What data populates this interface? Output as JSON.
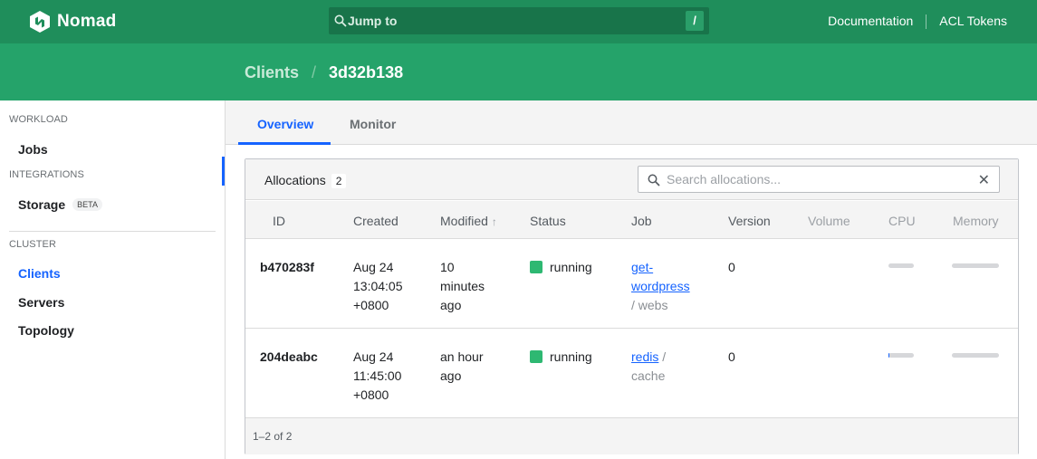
{
  "topnav": {
    "brand": "Nomad",
    "jump_label": "Jump to",
    "jump_key": "/",
    "links": [
      "Documentation",
      "ACL Tokens"
    ]
  },
  "breadcrumb": {
    "parent": "Clients",
    "separator": "/",
    "current": "3d32b138"
  },
  "sidebar": {
    "workload_label": "WORKLOAD",
    "jobs": "Jobs",
    "integrations_label": "INTEGRATIONS",
    "storage": "Storage",
    "storage_badge": "BETA",
    "cluster_label": "CLUSTER",
    "clients": "Clients",
    "servers": "Servers",
    "topology": "Topology"
  },
  "tabs": [
    "Overview",
    "Monitor"
  ],
  "allocations": {
    "title": "Allocations",
    "count": "2",
    "search_placeholder": "Search allocations...",
    "columns": [
      "ID",
      "Created",
      "Modified",
      "Status",
      "Job",
      "Version",
      "Volume",
      "CPU",
      "Memory"
    ],
    "sort_indicator": "↑",
    "rows": [
      {
        "id": "b470283f",
        "created": [
          "Aug 24",
          "13:04:05",
          "+0800"
        ],
        "modified": [
          "10",
          "minutes",
          "ago"
        ],
        "status": "running",
        "job_link": [
          "get-",
          "wordpress"
        ],
        "job_group": "/ webs",
        "version": "0",
        "cpu_usage": 0.0,
        "memory_usage": 0.0
      },
      {
        "id": "204deabc",
        "created": [
          "Aug 24",
          "11:45:00",
          "+0800"
        ],
        "modified": [
          "an hour",
          "ago"
        ],
        "status": "running",
        "job_link": [
          "redis"
        ],
        "job_group_inline": "/",
        "job_group": "cache",
        "version": "0",
        "cpu_usage": 0.03,
        "memory_usage": 0.0
      }
    ],
    "pagination": "1–2 of 2"
  },
  "colors": {
    "nav": "#1f8e5b",
    "subnav": "#25a36a",
    "accent": "#1563ff",
    "running": "#2eb872"
  }
}
